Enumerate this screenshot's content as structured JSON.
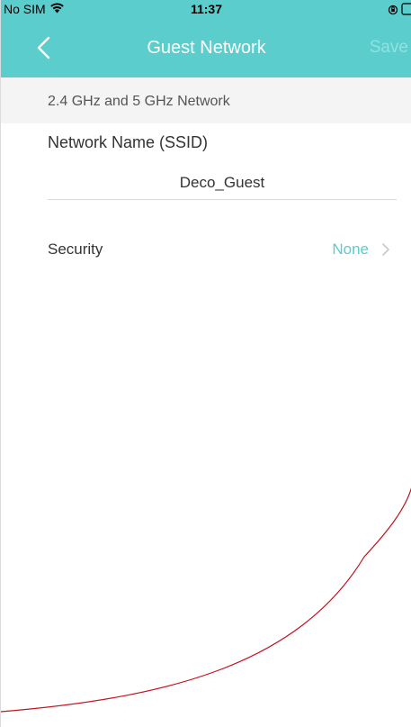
{
  "status_bar": {
    "carrier": "No SIM",
    "time": "11:37",
    "icons": [
      "wifi-icon",
      "orientation-lock-icon",
      "battery-icon"
    ]
  },
  "nav": {
    "title": "Guest Network",
    "save_label": "Save",
    "back_icon": "chevron-left-icon"
  },
  "section": {
    "header": "2.4 GHz and 5 GHz Network"
  },
  "ssid": {
    "label": "Network Name (SSID)",
    "value": "Deco_Guest"
  },
  "security": {
    "label": "Security",
    "value": "None",
    "icon": "chevron-right-icon"
  },
  "colors": {
    "accent": "#5bcdcc",
    "annotation_stroke": "#c0141e"
  }
}
